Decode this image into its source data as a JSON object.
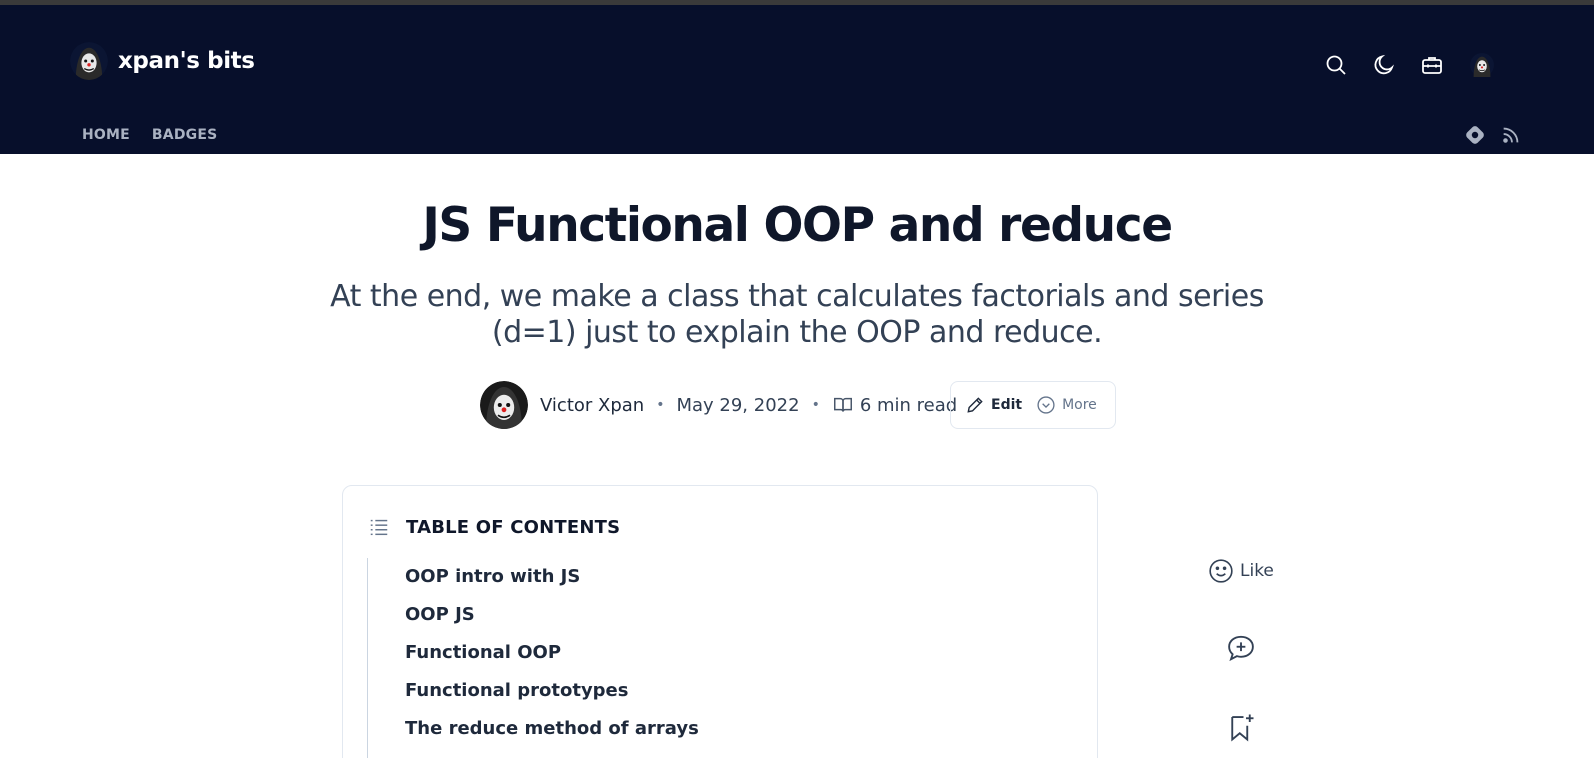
{
  "header": {
    "brand_name": "xpan's bits",
    "icons": [
      "search-icon",
      "moon-icon",
      "toolbox-icon",
      "user-avatar"
    ]
  },
  "nav": {
    "items": [
      {
        "label": "HOME"
      },
      {
        "label": "BADGES"
      }
    ],
    "icons": [
      "hashnode-icon",
      "rss-icon"
    ]
  },
  "article": {
    "title": "JS Functional OOP and reduce",
    "subtitle": "At the end, we make a class that calculates factorials and series (d=1) just to explain the OOP and reduce.",
    "author": "Victor Xpan",
    "date": "May 29, 2022",
    "read_time": "6 min read",
    "actions": {
      "edit_label": "Edit",
      "more_label": "More"
    }
  },
  "toc": {
    "title": "TABLE OF CONTENTS",
    "items": [
      {
        "label": "OOP intro with JS"
      },
      {
        "label": "OOP JS"
      },
      {
        "label": "Functional OOP"
      },
      {
        "label": "Functional prototypes"
      },
      {
        "label": "The reduce method of arrays"
      }
    ]
  },
  "side": {
    "like_label": "Like"
  },
  "colors": {
    "header_bg": "#070f2b",
    "text": "#0f172a",
    "muted": "#64748b"
  }
}
